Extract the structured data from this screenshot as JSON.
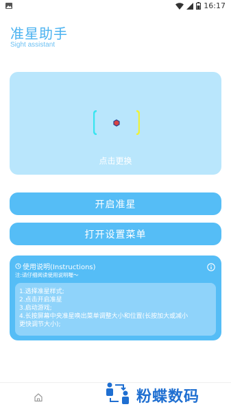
{
  "status_bar": {
    "time": "16:17"
  },
  "header": {
    "title": "准星助手",
    "subtitle": "Sight assistant"
  },
  "preview": {
    "change_label": "点击更换"
  },
  "buttons": {
    "open_crosshair": "开启准星",
    "open_settings_menu": "打开设置菜单"
  },
  "instructions": {
    "title": "使用说明(Instructions)",
    "note": "注:请仔细阅读使用说明喔〜",
    "steps": [
      "1.选择准星样式;",
      "2.点击开启准星",
      "3.启动游戏;",
      "4.长按屏幕中央准星唤出菜单调整大小和位置(长按加大或减小",
      "更快调节大小);"
    ]
  },
  "watermark": {
    "text": "粉蝶数码"
  },
  "icons": {
    "status_left": "image-icon",
    "wifi": "wifi-icon",
    "signal": "signal-icon",
    "battery": "battery-icon",
    "info": "info-icon",
    "clock": "clock-icon",
    "home": "home-icon"
  },
  "colors": {
    "accent": "#4ab2f0",
    "button": "#55bdf6",
    "preview_bg": "#b9e6fc",
    "crosshair_left": "#39e5f0",
    "crosshair_right": "#eef23a",
    "crosshair_center": "#d94343"
  }
}
